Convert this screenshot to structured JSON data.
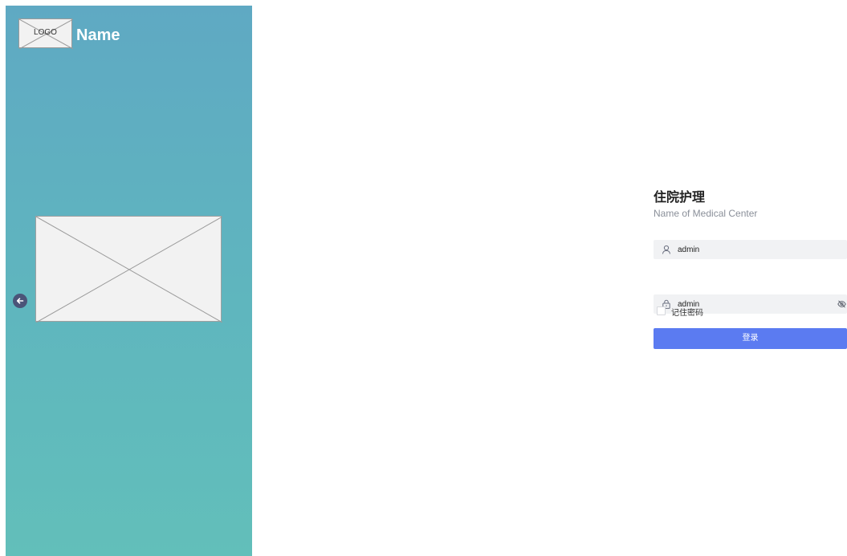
{
  "brand": {
    "logo_text": "LOGO",
    "name": "Name"
  },
  "login": {
    "title": "住院护理",
    "subtitle": "Name of Medical Center",
    "username_value": "admin",
    "password_value": "admin",
    "remember_label": "记住密码",
    "remember_checked": false,
    "submit_label": "登录"
  },
  "icons": {
    "collapse": "arrow-left-icon",
    "username": "user-icon",
    "password": "lock-icon",
    "visibility": "eye-off-icon"
  },
  "colors": {
    "panel_top": "#5fa9c3",
    "panel_bottom": "#62bfba",
    "primary": "#5b7bf1",
    "field_bg": "#f1f2f4",
    "collapse_btn": "#4b5478"
  }
}
